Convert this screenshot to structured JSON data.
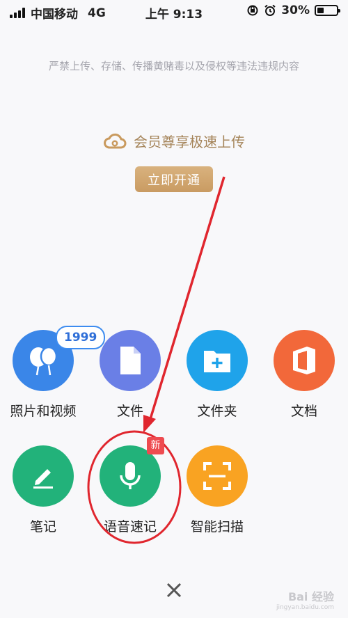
{
  "status_bar": {
    "carrier": "中国移动",
    "network": "4G",
    "time": "上午 9:13",
    "battery": "30%"
  },
  "notice": "严禁上传、存储、传播黄赌毒以及侵权等违法违规内容",
  "vip": {
    "text": "会员尊享极速上传",
    "button": "立即开通"
  },
  "upload_options": [
    {
      "label": "照片和视频",
      "icon": "photo-balloon-icon",
      "color": "#3a86e8"
    },
    {
      "label": "文件",
      "icon": "file-icon",
      "color": "#6a7fe6"
    },
    {
      "label": "文件夹",
      "icon": "folder-add-icon",
      "color": "#1fa3ea"
    },
    {
      "label": "文档",
      "icon": "office-icon",
      "color": "#f2683a"
    },
    {
      "label": "笔记",
      "icon": "pen-icon",
      "color": "#22b27a"
    },
    {
      "label": "语音速记",
      "icon": "microphone-icon",
      "color": "#22b27a"
    },
    {
      "label": "智能扫描",
      "icon": "scan-icon",
      "color": "#f9a322"
    }
  ],
  "photo_badge": "1999",
  "new_badge": "新",
  "close_icon": "close-icon",
  "watermark": {
    "brand": "Bai 经验",
    "url": "jingyan.baidu.com"
  },
  "annotation_color": "#e0262e"
}
